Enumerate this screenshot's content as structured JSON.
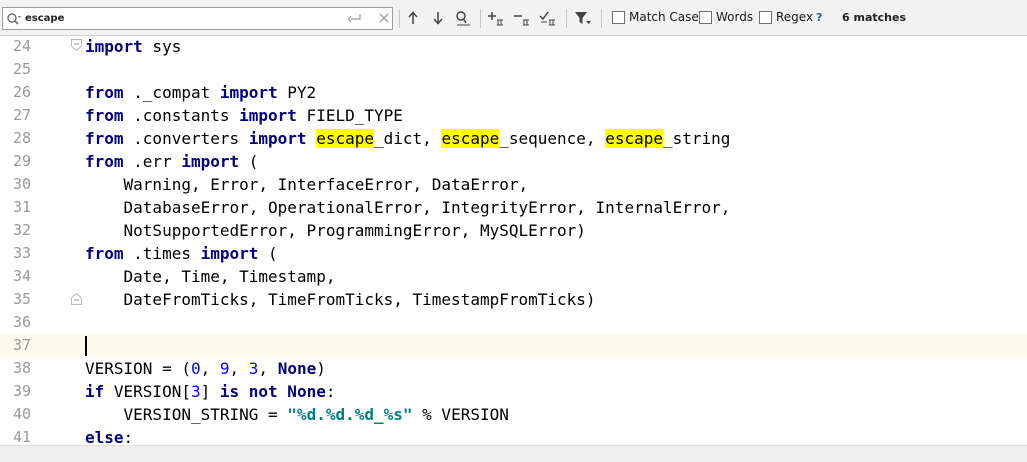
{
  "find_bar": {
    "query": "escape",
    "options": {
      "match_case": {
        "label": "Match Case",
        "checked": false
      },
      "words": {
        "label": "Words",
        "checked": false
      },
      "regex": {
        "label": "Regex",
        "checked": false
      }
    },
    "help": "?",
    "matches": "6 matches",
    "icons": [
      "search-history-icon",
      "enter-icon",
      "clear-icon",
      "previous-occurrence-icon",
      "next-occurrence-icon",
      "find-all-icon",
      "add-selection-icon",
      "remove-selection-icon",
      "select-all-occurrences-icon",
      "filter-icon"
    ]
  },
  "editor": {
    "current_line": "37",
    "lines": [
      {
        "num": "24",
        "tokens": [
          {
            "t": "import",
            "c": "kw"
          },
          {
            "t": " sys"
          }
        ]
      },
      {
        "num": "25",
        "tokens": []
      },
      {
        "num": "26",
        "tokens": [
          {
            "t": "from",
            "c": "kw"
          },
          {
            "t": " ._compat "
          },
          {
            "t": "import",
            "c": "kw"
          },
          {
            "t": " PY2"
          }
        ]
      },
      {
        "num": "27",
        "tokens": [
          {
            "t": "from",
            "c": "kw"
          },
          {
            "t": " .constants "
          },
          {
            "t": "import",
            "c": "kw"
          },
          {
            "t": " FIELD_TYPE"
          }
        ]
      },
      {
        "num": "28",
        "tokens": [
          {
            "t": "from",
            "c": "kw"
          },
          {
            "t": " .converters "
          },
          {
            "t": "import",
            "c": "kw"
          },
          {
            "t": " "
          },
          {
            "t": "escape",
            "c": "hl"
          },
          {
            "t": "_dict, "
          },
          {
            "t": "escape",
            "c": "hl"
          },
          {
            "t": "_sequence, "
          },
          {
            "t": "escape",
            "c": "hl"
          },
          {
            "t": "_string"
          }
        ]
      },
      {
        "num": "29",
        "tokens": [
          {
            "t": "from",
            "c": "kw"
          },
          {
            "t": " .err "
          },
          {
            "t": "import",
            "c": "kw"
          },
          {
            "t": " ("
          }
        ]
      },
      {
        "num": "30",
        "tokens": [
          {
            "t": "    Warning, Error, InterfaceError, DataError,"
          }
        ]
      },
      {
        "num": "31",
        "tokens": [
          {
            "t": "    DatabaseError, OperationalError, IntegrityError, InternalError,"
          }
        ]
      },
      {
        "num": "32",
        "tokens": [
          {
            "t": "    NotSupportedError, ProgrammingError, MySQLError)"
          }
        ]
      },
      {
        "num": "33",
        "tokens": [
          {
            "t": "from",
            "c": "kw"
          },
          {
            "t": " .times "
          },
          {
            "t": "import",
            "c": "kw"
          },
          {
            "t": " ("
          }
        ]
      },
      {
        "num": "34",
        "tokens": [
          {
            "t": "    Date, Time, Timestamp,"
          }
        ]
      },
      {
        "num": "35",
        "tokens": [
          {
            "t": "    DateFromTicks, TimeFromTicks, TimestampFromTicks)"
          }
        ]
      },
      {
        "num": "36",
        "tokens": []
      },
      {
        "num": "37",
        "tokens": []
      },
      {
        "num": "38",
        "tokens": [
          {
            "t": "VERSION = ("
          },
          {
            "t": "0",
            "c": "num"
          },
          {
            "t": ", "
          },
          {
            "t": "9",
            "c": "num"
          },
          {
            "t": ", "
          },
          {
            "t": "3",
            "c": "num"
          },
          {
            "t": ", "
          },
          {
            "t": "None",
            "c": "kw"
          },
          {
            "t": ")"
          }
        ]
      },
      {
        "num": "39",
        "tokens": [
          {
            "t": "if",
            "c": "kw"
          },
          {
            "t": " VERSION["
          },
          {
            "t": "3",
            "c": "num"
          },
          {
            "t": "] "
          },
          {
            "t": "is not None",
            "c": "kw"
          },
          {
            "t": ":"
          }
        ]
      },
      {
        "num": "40",
        "tokens": [
          {
            "t": "    VERSION_STRING = "
          },
          {
            "t": "\"%d.%d.%d_%s\"",
            "c": "str"
          },
          {
            "t": " % VERSION"
          }
        ]
      },
      {
        "num": "41",
        "tokens": [
          {
            "t": "else",
            "c": "kw"
          },
          {
            "t": ":"
          }
        ]
      }
    ]
  },
  "colors": {
    "keyword": "#000080",
    "number": "#0000ff",
    "string": "#008080",
    "match_highlight": "#ffff00",
    "current_line": "#fcfaed",
    "line_number": "#999999"
  }
}
